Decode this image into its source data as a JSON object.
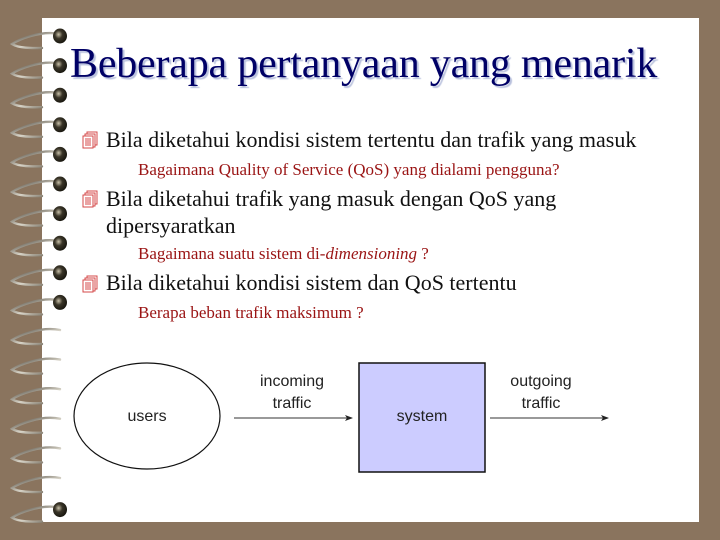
{
  "slide": {
    "title": "Beberapa pertanyaan yang menarik",
    "bullet_icon": "document-stack-icon",
    "items": [
      {
        "text": "Bila diketahui kondisi sistem tertentu dan trafik yang masuk",
        "sub": "Bagaimana Quality of Service (QoS) yang dialami pengguna?"
      },
      {
        "text": "Bila diketahui trafik yang masuk dengan QoS yang",
        "text_line2": "dipersyaratkan",
        "sub_prefix": "Bagaimana suatu sistem di-",
        "sub_italic": "dimensioning",
        "sub_suffix": " ?"
      },
      {
        "text": "Bila diketahui kondisi sistem dan QoS tertentu",
        "sub": "Berapa beban trafik maksimum ?"
      }
    ]
  },
  "diagram": {
    "users_label": "users",
    "incoming_line1": "incoming",
    "incoming_line2": "traffic",
    "system_label": "system",
    "outgoing_line1": "outgoing",
    "outgoing_line2": "traffic"
  },
  "colors": {
    "background": "#8a745e",
    "title": "#000066",
    "sub_text": "#9a1414",
    "system_fill": "#ccccff",
    "bullet": "#d44a4a"
  }
}
